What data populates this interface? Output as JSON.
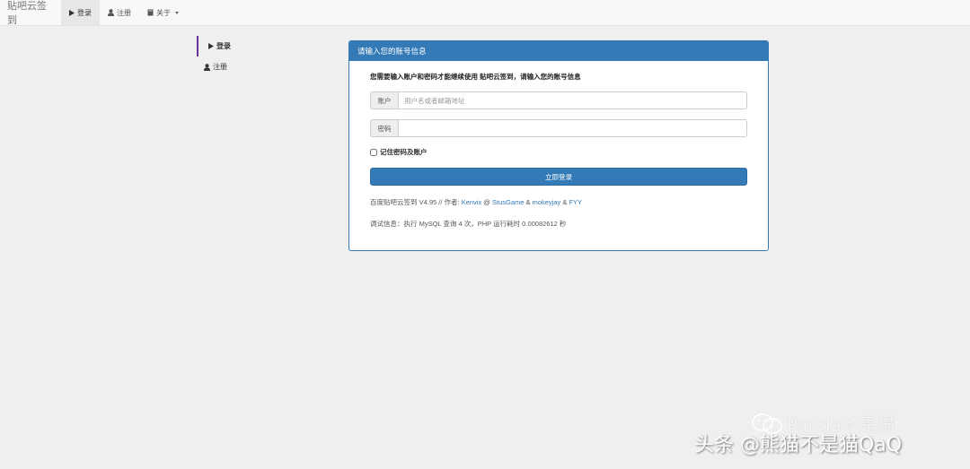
{
  "navbar": {
    "brand": "贴吧云签到",
    "items": [
      {
        "label": "登录",
        "icon": "play-icon",
        "active": true
      },
      {
        "label": "注册",
        "icon": "user-icon"
      },
      {
        "label": "关于",
        "icon": "book-icon",
        "dropdown": true
      }
    ]
  },
  "sidebar": {
    "items": [
      {
        "label": "登录",
        "icon": "play-icon",
        "active": true
      },
      {
        "label": "注册",
        "icon": "user-icon"
      }
    ]
  },
  "panel": {
    "heading": "请输入您的账号信息",
    "notice": "您需要输入账户和密码才能继续使用 贴吧云签到，请输入您的账号信息",
    "account_addon": "账户",
    "account_placeholder": "用户名或者邮箱地址",
    "account_value": "",
    "password_addon": "密码",
    "password_value": "",
    "remember_label": "记住密码及账户",
    "submit_label": "立即登录",
    "footer": {
      "prefix": "百度贴吧云签到 V4.95 // 作者: ",
      "author1": "Kenvix",
      "sep1": " @ ",
      "author2": "StusGame",
      "sep2": " & ",
      "author3": "mokeyjay",
      "sep3": " & ",
      "author4": "FYY"
    },
    "debug": "调试信息：执行 MySQL 查询 4 次，PHP 运行耗时 0.00082612 秒"
  },
  "watermark": {
    "line1": "Panda不是猫",
    "line2": "头条 @熊猫不是猫QaQ"
  },
  "colors": {
    "primary": "#337ab7",
    "sidebar_active": "#663399",
    "background": "#efefef"
  }
}
